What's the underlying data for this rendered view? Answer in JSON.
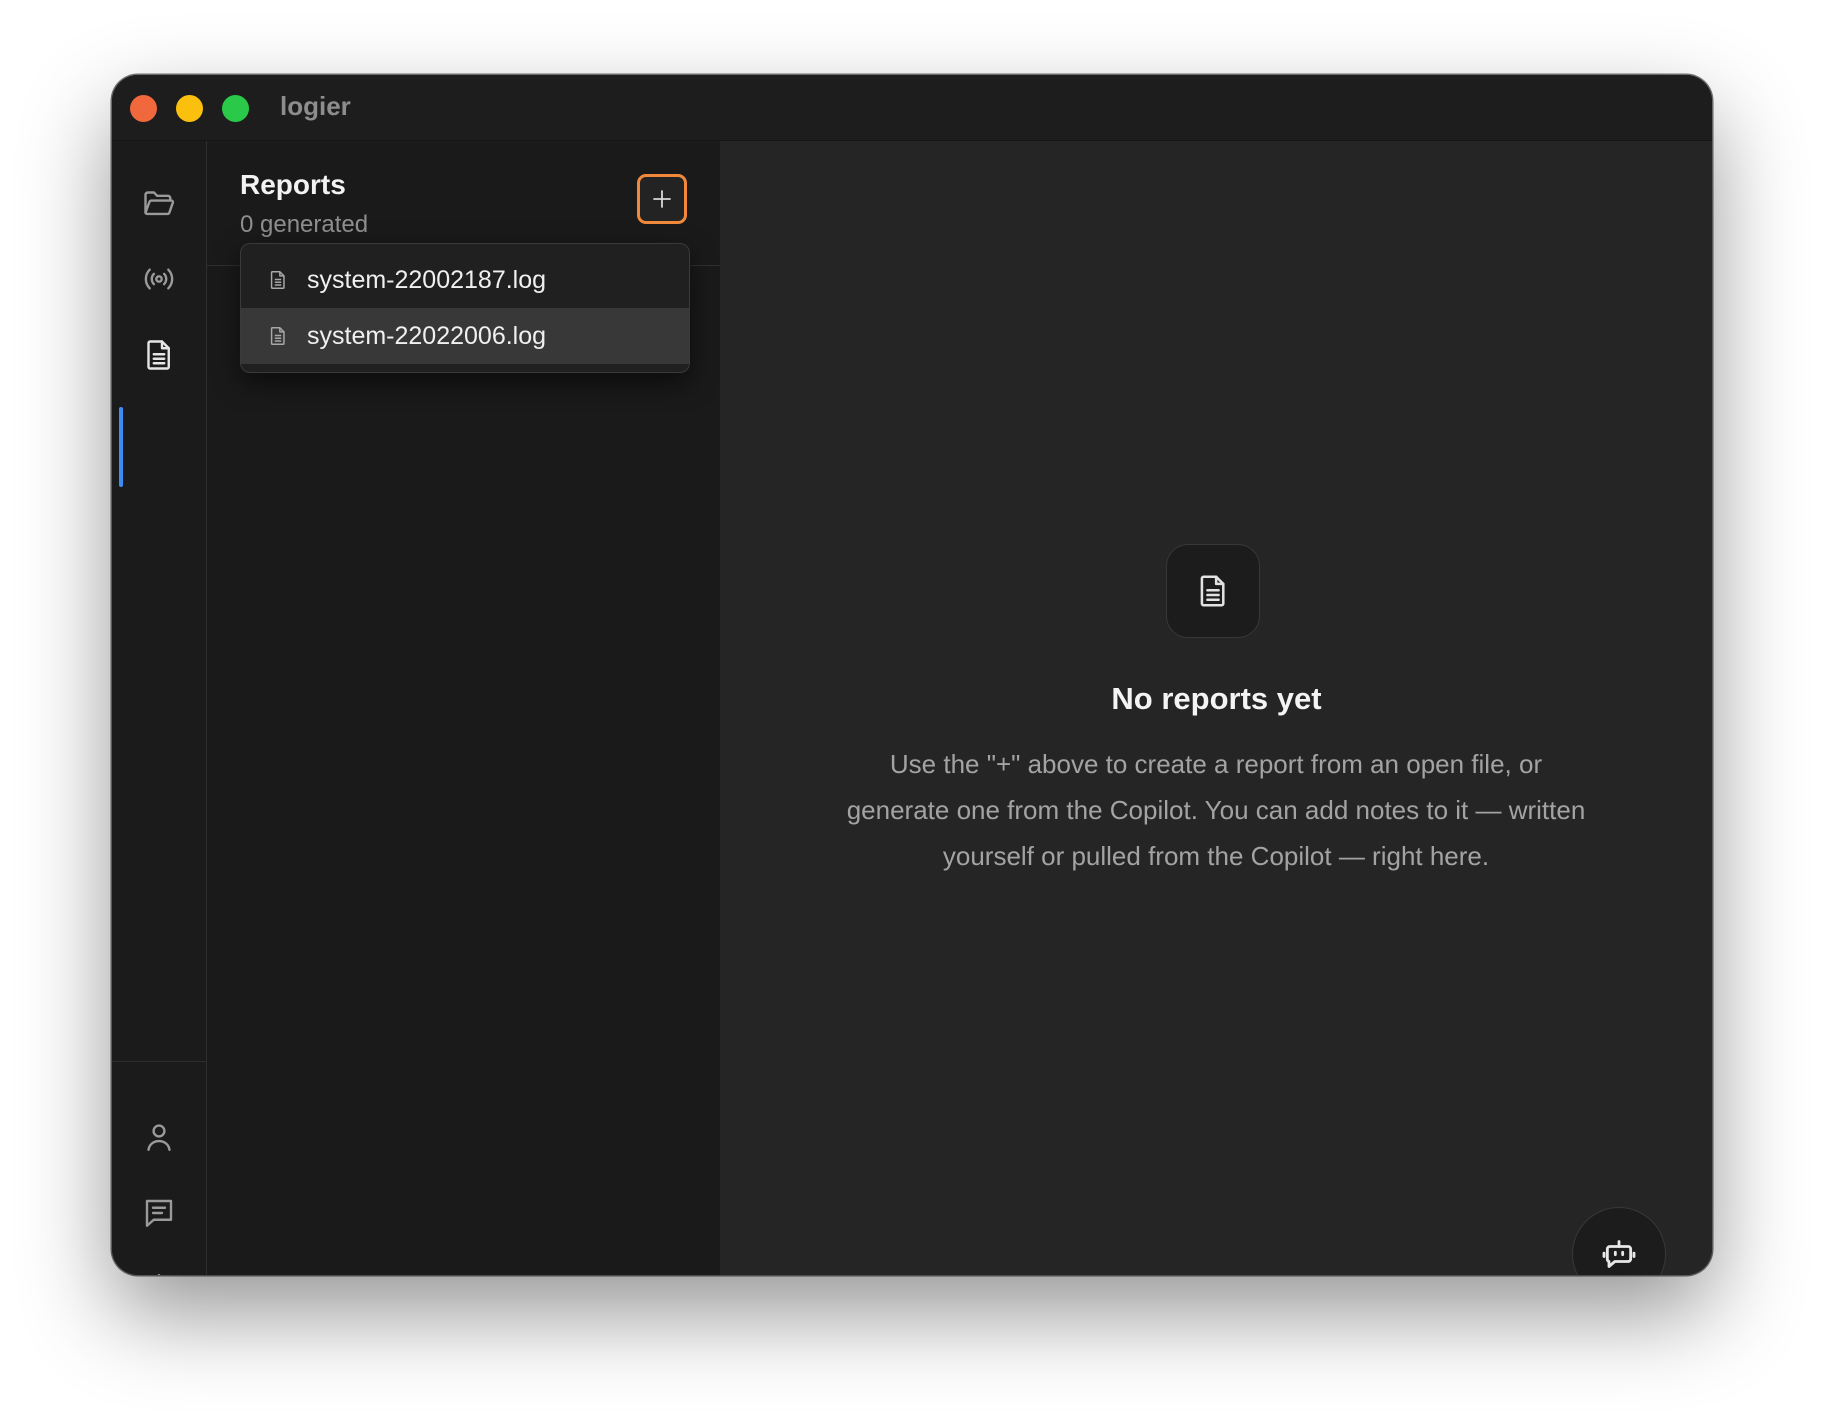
{
  "window": {
    "title": "logier"
  },
  "rail": {
    "top_items": [
      {
        "icon": "folder-open-icon",
        "label": "Files"
      },
      {
        "icon": "broadcast-icon",
        "label": "Live"
      },
      {
        "icon": "document-icon",
        "label": "Reports",
        "active": true
      }
    ],
    "bottom_items": [
      {
        "icon": "user-icon"
      },
      {
        "icon": "message-icon"
      },
      {
        "icon": "gear-icon"
      }
    ],
    "accent_color": "#3b8cf5"
  },
  "panel": {
    "title": "Reports",
    "subtitle": "0 generated",
    "add_button_label": "+",
    "dropdown": {
      "items": [
        {
          "label": "system-22002187.log",
          "icon": "file-icon"
        },
        {
          "label": "system-22022006.log",
          "icon": "file-icon",
          "highlighted": true
        }
      ]
    }
  },
  "main": {
    "empty_state": {
      "icon": "document-icon",
      "title": "No reports yet",
      "description": "Use the \"+\" above to create a report from an open file, or generate one from the Copilot. You can add notes to it — written yourself or pulled from the Copilot — right here."
    },
    "fab_icon": "bot-icon"
  },
  "colors": {
    "focus_ring": "#f08a3a",
    "traffic_red": "#f0683c",
    "traffic_yellow": "#fbc00e",
    "traffic_green": "#2ac94a"
  }
}
